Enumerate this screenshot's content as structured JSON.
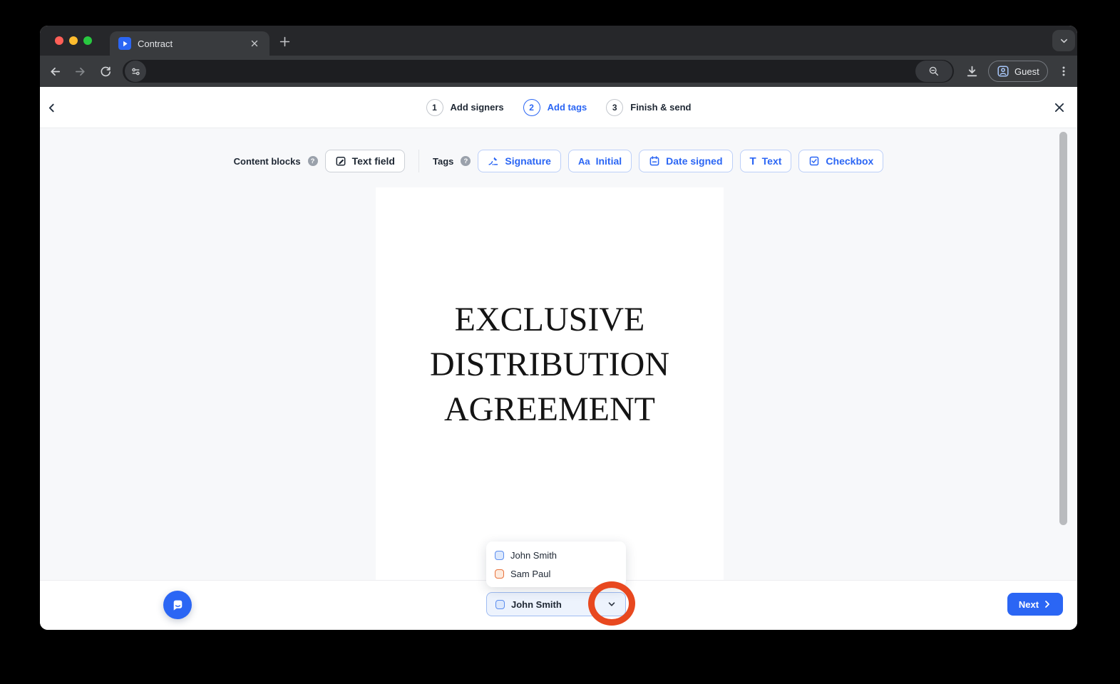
{
  "browser": {
    "tab_title": "Contract",
    "guest_label": "Guest"
  },
  "stepper": {
    "steps": [
      {
        "num": "1",
        "label": "Add signers"
      },
      {
        "num": "2",
        "label": "Add tags"
      },
      {
        "num": "3",
        "label": "Finish & send"
      }
    ],
    "active_step": "Add tags"
  },
  "blocks_toolbar": {
    "content_blocks_label": "Content blocks",
    "help_glyph": "?",
    "text_field_label": "Text field",
    "tags_label": "Tags",
    "tag_buttons": [
      {
        "label": "Signature"
      },
      {
        "label": "Initial",
        "icon_glyph": "Aa"
      },
      {
        "label": "Date signed"
      },
      {
        "label": "Text",
        "icon_glyph": "T"
      },
      {
        "label": "Checkbox"
      }
    ]
  },
  "document": {
    "title_lines": [
      "EXCLUSIVE",
      "DISTRIBUTION",
      "AGREEMENT"
    ]
  },
  "signer_select": {
    "selected": {
      "name": "John Smith",
      "color": "blue"
    },
    "options": [
      {
        "name": "John Smith",
        "color": "blue"
      },
      {
        "name": "Sam Paul",
        "color": "orange"
      }
    ]
  },
  "footer": {
    "next_label": "Next"
  },
  "colors": {
    "accent_blue": "#2b66f4",
    "annotation_red": "#e8481f",
    "signer_blue_border": "#5b8def",
    "signer_blue_fill": "#dce8fc",
    "signer_orange_border": "#e8713a",
    "signer_orange_fill": "#fdeadd"
  }
}
